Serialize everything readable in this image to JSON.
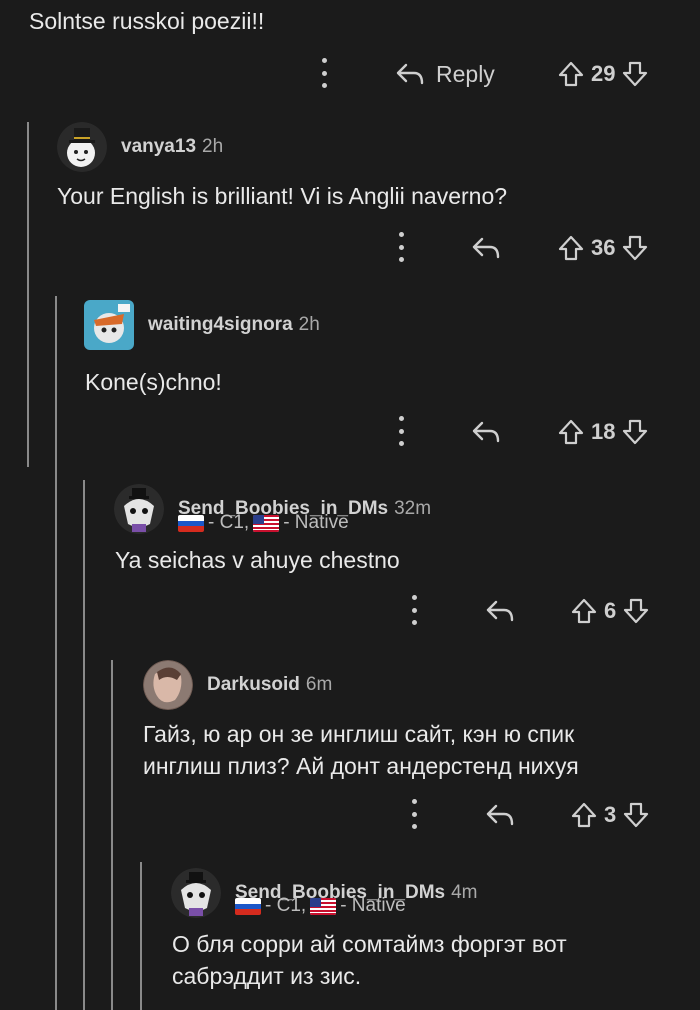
{
  "top_comment": {
    "text": "Solntse russkoi poezii!!",
    "reply_label": "Reply",
    "score": "29"
  },
  "comments": [
    {
      "username": "vanya13",
      "age": "2h",
      "text_lines": [
        "Your English is brilliant! Vi is Anglii naverno?"
      ],
      "score": "36"
    },
    {
      "username": "waiting4signora",
      "age": "2h",
      "text_lines": [
        "Kone(s)chno!"
      ],
      "score": "18"
    },
    {
      "username": "Send_Boobies_in_DMs",
      "age": "32m",
      "flair": {
        "level": "- C1,",
        "native": "- Native"
      },
      "text_lines": [
        "Ya seichas v ahuye chestno"
      ],
      "score": "6"
    },
    {
      "username": "Darkusoid",
      "age": "6m",
      "text_lines": [
        "Гайз, ю ар он зе инглиш сайт, кэн ю спик",
        "инглиш плиз? Ай донт андерстенд нихуя"
      ],
      "score": "3"
    },
    {
      "username": "Send_Boobies_in_DMs",
      "age": "4m",
      "flair": {
        "level": "- C1,",
        "native": "- Native"
      },
      "text_lines": [
        "О бля сорри ай сомтаймз форгэт вот",
        "сабрэддит из зис."
      ]
    }
  ],
  "icons": {
    "more": "more-vertical-icon",
    "reply": "reply-arrow-icon",
    "upvote": "upvote-arrow-icon",
    "downvote": "downvote-arrow-icon",
    "flag_ru": "russia-flag-icon",
    "flag_us": "usa-flag-icon"
  },
  "colors": {
    "background": "#1b1b1b",
    "text": "#e9e9e9",
    "muted": "#a9a9a9",
    "thread_line": "#8a8a8a"
  }
}
